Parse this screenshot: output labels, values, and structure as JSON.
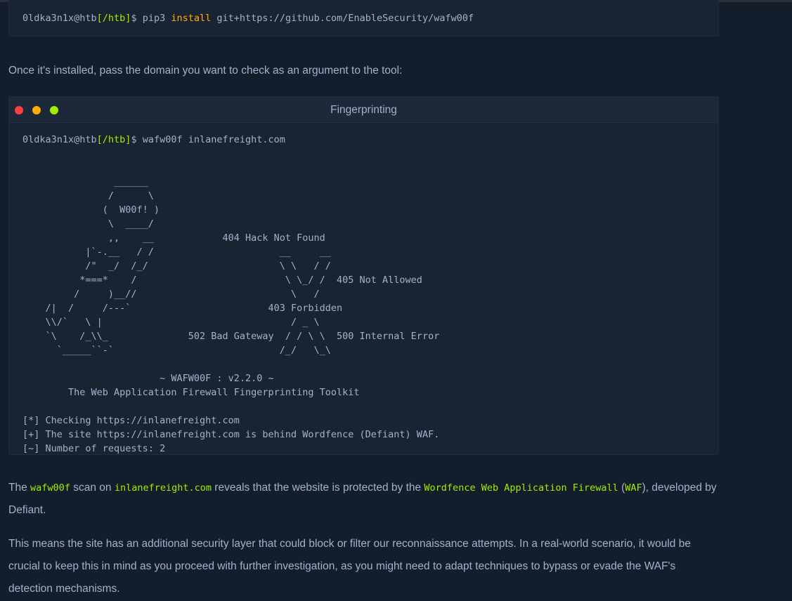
{
  "install_block": {
    "prompt_user": "0ldka3n1x@htb",
    "prompt_path": "[/htb]",
    "prompt_dollar": "$",
    "cmd_pre": "pip3 ",
    "cmd_kw": "install",
    "cmd_post": " git+https://github.com/EnableSecurity/wafw00f"
  },
  "intro_text": "Once it's installed, pass the domain you want to check as an argument to the tool:",
  "terminal": {
    "title": "Fingerprinting",
    "prompt_user": "0ldka3n1x@htb",
    "prompt_path": "[/htb]",
    "prompt_dollar": "$",
    "command": " wafw00f inlanefreight.com",
    "output": "\n\n                ______\n               /      \\\n              (  W00f! )\n               \\  ____/\n               ,,    __            404 Hack Not Found\n           |`-.__   / /                      __     __\n           /\"  _/  /_/                       \\ \\   / /\n          *===*    /                          \\ \\_/ /  405 Not Allowed\n         /     )__//                           \\   /\n    /|  /     /---`                        403 Forbidden\n    \\\\/`   \\ |                                 / _ \\\n    `\\    /_\\\\_              502 Bad Gateway  / / \\ \\  500 Internal Error\n      `_____``-`                             /_/   \\_\\\n\n                        ~ WAFW00F : v2.2.0 ~\n        The Web Application Firewall Fingerprinting Toolkit\n\n[*] Checking https://inlanefreight.com\n[+] The site https://inlanefreight.com is behind Wordfence (Defiant) WAF.\n[~] Number of requests: 2"
  },
  "result_para": {
    "p1": "The ",
    "c1": "wafw00f",
    "p2": " scan on ",
    "c2": "inlanefreight.com",
    "p3": " reveals that the website is protected by the ",
    "c3": "Wordfence Web Application Firewall",
    "p4": " (",
    "c4": "WAF",
    "p5": "), developed by Defiant."
  },
  "final_text": "This means the site has an additional security layer that could block or filter our reconnaissance attempts. In a real-world scenario, it would be crucial to keep this in mind as you proceed with further investigation, as you might need to adapt techniques to bypass or evade the WAF's detection mechanisms.",
  "colors": {
    "background": "#141d2b",
    "terminal_bg": "#1a2332",
    "accent_green": "#9fef00",
    "accent_orange": "#ffaf00",
    "dot_red": "#ff3e3e"
  }
}
